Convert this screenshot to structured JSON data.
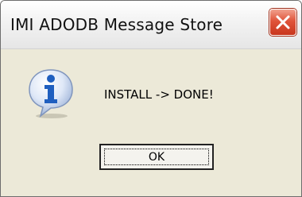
{
  "window": {
    "title": "IMI ADODB Message Store",
    "close_icon": "close-icon"
  },
  "dialog": {
    "icon": "info-icon",
    "message": "INSTALL -> DONE!",
    "ok_label": "OK"
  },
  "colors": {
    "dialog_background": "#ece9d8",
    "close_button": "#e0543a",
    "info_icon_blue": "#1f5fbf"
  }
}
